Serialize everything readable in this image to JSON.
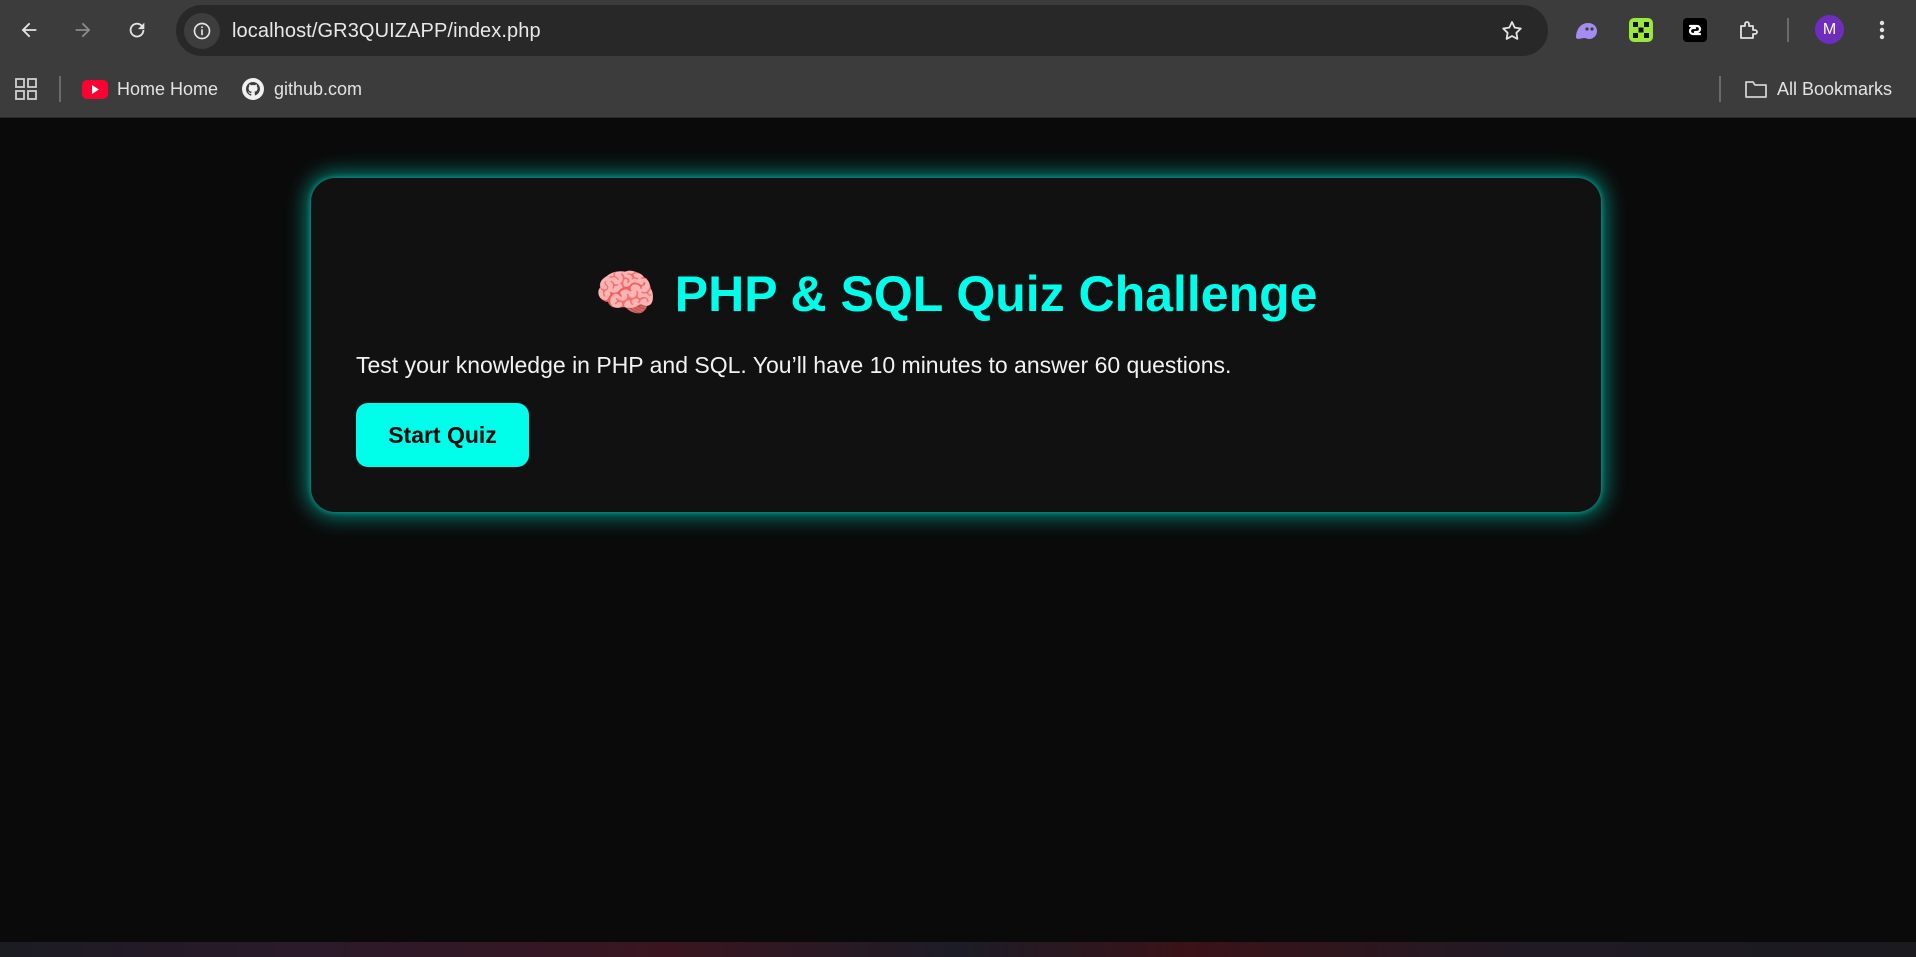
{
  "browser": {
    "url": "localhost/GR3QUIZAPP/index.php",
    "profile_initial": "M",
    "icons": {
      "back": "arrow-left-icon",
      "forward": "arrow-right-icon",
      "reload": "reload-icon",
      "site_info": "info-icon",
      "bookmark_star": "star-icon",
      "extensions": "puzzle-icon",
      "menu": "more-vertical-icon"
    }
  },
  "bookmarks": {
    "items": [
      {
        "label": "Home Home",
        "icon": "youtube-icon"
      },
      {
        "label": "github.com",
        "icon": "github-icon"
      }
    ],
    "all_bookmarks_label": "All Bookmarks"
  },
  "quiz": {
    "title": "PHP & SQL Quiz Challenge",
    "title_emoji": "🧠",
    "description": "Test your knowledge in PHP and SQL. You’ll have 10 minutes to answer 60 questions.",
    "start_button_label": "Start Quiz"
  },
  "colors": {
    "accent": "#00ffea",
    "page_background": "#0a0a0a",
    "card_background": "#111111",
    "toolbar_background": "#3c3c3c"
  }
}
